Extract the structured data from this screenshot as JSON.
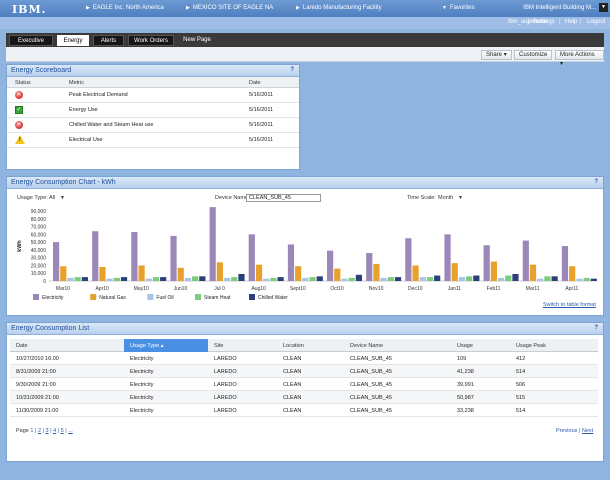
{
  "header": {
    "logo": "IBM.",
    "breadcrumbs": [
      "EAGLE Inc. North America",
      "MEXICO SITE OF EAGLE NA",
      "Laredo Manufacturing Facility"
    ],
    "favorites": "Favorites",
    "app_name": "IBM Intelligent Building M..."
  },
  "util": {
    "user": "ibm_superuser",
    "settings": "Settings",
    "help": "Help",
    "logout": "Logout"
  },
  "tabs": [
    {
      "label": "Executive"
    },
    {
      "label": "Energy"
    },
    {
      "label": "Alerts"
    },
    {
      "label": "Work Orders"
    },
    {
      "label": "New Page"
    }
  ],
  "actions": {
    "share": "Share",
    "customize": "Customize",
    "more": "More Actions"
  },
  "scoreboard": {
    "title": "Energy Scoreboard",
    "help": "?",
    "columns": {
      "status": "Status",
      "metric": "Metric",
      "date": "Date"
    },
    "rows": [
      {
        "status": "red",
        "metric": "Peak Electrical Demand",
        "date": "5/16/2011"
      },
      {
        "status": "green",
        "metric": "Energy Use",
        "date": "5/16/2011"
      },
      {
        "status": "red",
        "metric": "Chilled Water and Steam Heat use",
        "date": "5/16/2011"
      },
      {
        "status": "warn",
        "metric": "Electrical Use",
        "date": "5/16/2011"
      }
    ]
  },
  "chart_panel": {
    "title": "Energy Consumption Chart - kWh",
    "help": "?",
    "usage_type_label": "Usage Type:",
    "usage_type_value": "All",
    "device_label": "Device Name:",
    "device_value": "CLEAN_SUB_45",
    "time_scale_label": "Time Scale:",
    "time_scale_value": "Month",
    "switch_link": "Switch to table format"
  },
  "chart_data": {
    "type": "bar",
    "ylabel": "kWh",
    "ylim": [
      0,
      90000
    ],
    "yticks": [
      "0",
      "10,000",
      "20,000",
      "30,000",
      "40,000",
      "50,000",
      "60,000",
      "70,000",
      "80,000",
      "90,000"
    ],
    "categories": [
      "Mar10",
      "Apr10",
      "May10",
      "Jun10",
      "Jul10",
      "Aug10",
      "Sept10",
      "Oct10",
      "Nov10",
      "Dec10",
      "Jan11",
      "Feb11",
      "Mar11",
      "Apr11"
    ],
    "xtick_labels": [
      "Mar10",
      "Apr10",
      "May10",
      "Jun10",
      "Jul10",
      "Aug10",
      "Sept10",
      "Oct10",
      "Nov10",
      "Dec10",
      "Jan11",
      "Feb11",
      "Mar11",
      "Apr11"
    ],
    "shown_x_labels": [
      "Mar10",
      "Apr10",
      "May10",
      "Jun10",
      "Jul 0",
      "Aug10",
      "Sept10",
      "Oct10",
      "Nov10",
      "Dec10",
      "Jan11",
      "Feb11",
      "Mar11",
      "Apr11"
    ],
    "series": [
      {
        "name": "Electricity",
        "color": "#9b87b8",
        "values": [
          50000,
          64000,
          63000,
          58000,
          95000,
          60000,
          47000,
          39000,
          36000,
          55000,
          60000,
          46000,
          52000,
          45000
        ]
      },
      {
        "name": "Natural Gas",
        "color": "#e8a22c",
        "values": [
          19000,
          18000,
          20000,
          17000,
          24000,
          21000,
          19000,
          16000,
          22000,
          20000,
          23000,
          25000,
          21000,
          19000
        ]
      },
      {
        "name": "Fuel Oil",
        "color": "#a8c4e8",
        "values": [
          4000,
          3000,
          3000,
          4000,
          4000,
          3000,
          4000,
          3000,
          4000,
          5000,
          5000,
          4000,
          3000,
          3000
        ]
      },
      {
        "name": "Steam Heat",
        "color": "#7dcc7d",
        "values": [
          5000,
          4000,
          5000,
          6000,
          5000,
          4000,
          5000,
          4000,
          5000,
          5000,
          6000,
          7000,
          6000,
          4000
        ]
      },
      {
        "name": "Chilled Water",
        "color": "#2d3f7a",
        "values": [
          5000,
          5000,
          5000,
          6000,
          9000,
          5000,
          6000,
          8000,
          5000,
          7000,
          7000,
          9000,
          6000,
          3000
        ]
      }
    ],
    "grid": false,
    "legend": "bottom"
  },
  "list": {
    "title": "Energy Consumption List",
    "help": "?",
    "columns": [
      "Date",
      "Usage Type",
      "Site",
      "Location",
      "Device Name",
      "Usage",
      "Usage Peak"
    ],
    "rows": [
      [
        "10/27/2010 16:00",
        "Electricity",
        "LAREDO",
        "CLEAN",
        "CLEAN_SUB_45",
        "109",
        "412"
      ],
      [
        "8/31/2009 21:00",
        "Electricity",
        "LAREDO",
        "CLEAN",
        "CLEAN_SUB_45",
        "41,238",
        "514"
      ],
      [
        "9/30/2009 21:00",
        "Electricity",
        "LAREDO",
        "CLEAN",
        "CLEAN_SUB_45",
        "39,991",
        "506"
      ],
      [
        "10/31/2009 21:00",
        "Electricity",
        "LAREDO",
        "CLEAN",
        "CLEAN_SUB_45",
        "50,987",
        "515"
      ],
      [
        "11/30/2009 21:00",
        "Electricity",
        "LAREDO",
        "CLEAN",
        "CLEAN_SUB_45",
        "33,238",
        "514"
      ]
    ],
    "pager": {
      "label": "Page",
      "pages": [
        "1",
        "2",
        "3",
        "4",
        "5",
        "..."
      ],
      "previous": "Previous",
      "next": "Next"
    }
  }
}
